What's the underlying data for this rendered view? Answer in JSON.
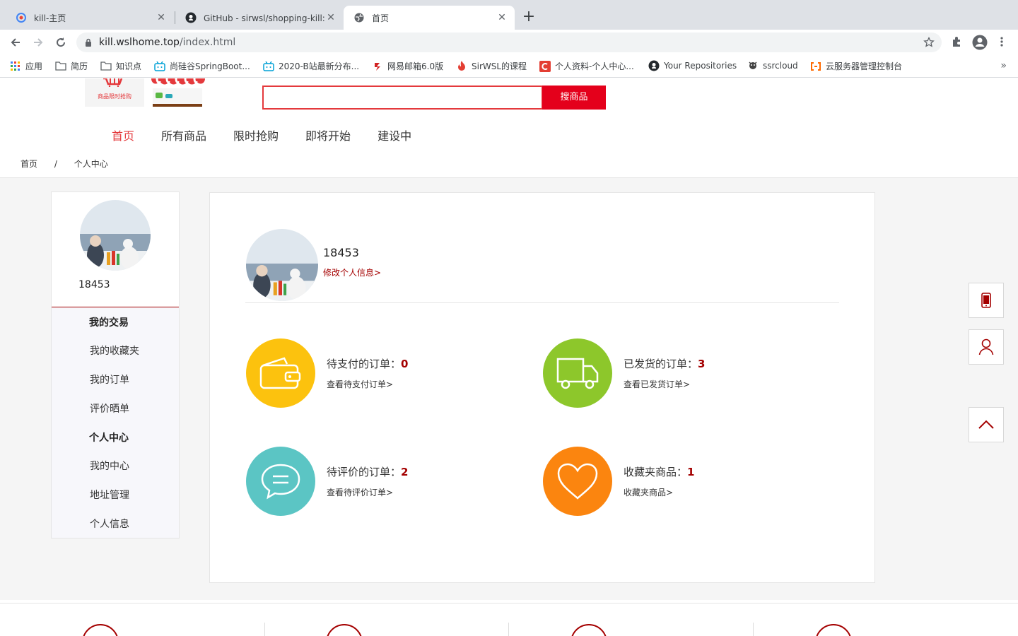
{
  "browser": {
    "tabs": [
      {
        "title": "kill-主页",
        "icon": "kill-favicon"
      },
      {
        "title": "GitHub - sirwsl/shopping-kill: 基",
        "icon": "github-icon"
      },
      {
        "title": "首页",
        "icon": "globe-icon"
      }
    ],
    "url_host": "kill.wslhome.top",
    "url_path": "/index.html",
    "bookmarks": [
      {
        "label": "应用",
        "icon": "apps-grid-icon"
      },
      {
        "label": "简历",
        "icon": "folder-icon"
      },
      {
        "label": "知识点",
        "icon": "folder-icon"
      },
      {
        "label": "尚硅谷SpringBoot...",
        "icon": "bilibili-icon"
      },
      {
        "label": "2020-B站最新分布...",
        "icon": "bilibili-icon"
      },
      {
        "label": "网易邮箱6.0版",
        "icon": "netease-icon"
      },
      {
        "label": "SirWSL的课程",
        "icon": "flame-icon"
      },
      {
        "label": "个人资料-个人中心...",
        "icon": "csdn-icon"
      },
      {
        "label": "Your Repositories",
        "icon": "github-icon"
      },
      {
        "label": "ssrcloud",
        "icon": "ssrcloud-icon"
      },
      {
        "label": "云服务器管理控制台",
        "icon": "aliyun-icon"
      }
    ]
  },
  "header": {
    "logo_text": "商品限时抢购",
    "search_placeholder": "",
    "search_button": "搜商品"
  },
  "nav": {
    "items": [
      "首页",
      "所有商品",
      "限时抢购",
      "即将开始",
      "建设中"
    ],
    "active": "首页"
  },
  "breadcrumb": {
    "items": [
      "首页",
      "/",
      "个人中心"
    ]
  },
  "sidebar": {
    "username": "18453",
    "menu": [
      {
        "label": "我的交易",
        "type": "group"
      },
      {
        "label": "我的收藏夹",
        "type": "item"
      },
      {
        "label": "我的订单",
        "type": "item"
      },
      {
        "label": "评价晒单",
        "type": "item"
      },
      {
        "label": "个人中心",
        "type": "group"
      },
      {
        "label": "我的中心",
        "type": "item"
      },
      {
        "label": "地址管理",
        "type": "item"
      },
      {
        "label": "个人信息",
        "type": "item"
      }
    ]
  },
  "profile": {
    "username": "18453",
    "edit_link": "修改个人信息>"
  },
  "stats": [
    {
      "label": "待支付的订单：",
      "count": "0",
      "link": "查看待支付订单>",
      "color": "#fcc20e",
      "icon": "wallet-icon"
    },
    {
      "label": "已发货的订单：",
      "count": "3",
      "link": "查看已发货订单>",
      "color": "#8dc72b",
      "icon": "truck-icon"
    },
    {
      "label": "待评价的订单：",
      "count": "2",
      "link": "查看待评价订单>",
      "color": "#5bc5c4",
      "icon": "comment-icon"
    },
    {
      "label": "收藏夹商品：",
      "count": "1",
      "link": "收藏夹商品>",
      "color": "#fb850f",
      "icon": "heart-icon"
    }
  ],
  "colors": {
    "brand_red": "#e4393c",
    "accent_dark_red": "#a40000",
    "search_button": "#e4001b"
  },
  "float_buttons": [
    "phone-icon",
    "user-icon",
    "back-to-top-icon"
  ]
}
